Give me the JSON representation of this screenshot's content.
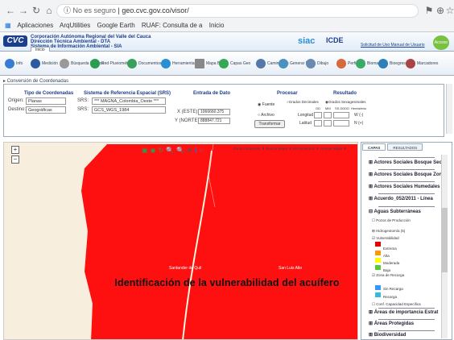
{
  "browser": {
    "url_prefix": "No es seguro",
    "url": "geo.cvc.gov.co/visor/",
    "bookmarks": [
      "Aplicaciones",
      "ArqUtilities",
      "Google Earth",
      "RUAF: Consulta de a",
      "Inicio"
    ]
  },
  "banner": {
    "logo": "CVC",
    "org_lines": [
      "Corporación Autónoma Regional del Valle del Cauca",
      "Dirección Técnica Ambiental - DTA",
      "Sistema de Información Ambiental - SIA"
    ],
    "siac": "siac",
    "icde": "ICDE",
    "manual": "Solicitud de Uso Manual de Usuario",
    "avatar": "Acceso",
    "tab": "Inicio"
  },
  "toolbar": {
    "items": [
      "Info",
      "Medición",
      "Búsqueda Predios",
      "Red Pluviométrica",
      "Documentos",
      "Herramientas",
      "Mapa Base",
      "Capas Geo",
      "Caminantes",
      "Generar Mapa",
      "Dibujo",
      "Perfil",
      "Biomas",
      "Bioegresar",
      "Marcadores",
      "Consultar"
    ]
  },
  "panel": {
    "header": "Conversión de Coordenadas",
    "tipo_title": "Tipo de Coordenadas",
    "sistema_title": "Sistema de Referencia Espacial (SRS)",
    "entrada_title": "Entrada de Dato",
    "procesar_title": "Procesar",
    "resultado_title": "Resultado",
    "origen_label": "Origen:",
    "origen_value": "Planas",
    "destino_label": "Destino:",
    "destino_value": "Geográficas",
    "srs1_label": "SRS:",
    "srs1_value": "*** MAGNA_Colombia_Oeste ***",
    "srs2_label": "SRS:",
    "srs2_value": "GCS_WGS_1984",
    "x_label": "X (ESTE):",
    "x_value": "1066660.375",
    "y_label": "Y (NORTE):",
    "y_value": "888847.721",
    "fuente": "Fuente",
    "archivo": "Archivo",
    "radio_dec": "Grados Decimales",
    "radio_sex": "Grados Sexagesimales",
    "col_gd": "GD",
    "col_mm": "MM",
    "col_ss": "SS.DDDD",
    "col_hemi": "Hemisferio",
    "longitud": "Longitud",
    "latitud": "Latitud",
    "hemi_w": "W (-)",
    "hemi_n": "N (+)",
    "transform": "Transformar"
  },
  "map": {
    "menus": "Zona Condensar ▼   Buscar Mapa ▼   Herramientas ▼   Limpiar Mapa ▼",
    "label_left": "Santander de Quil",
    "label_right": "San Luis Alto",
    "caption": "Identificación de la vulnerabilidad del acuífero",
    "fill_color": "#ff1010"
  },
  "layers": {
    "tabs": [
      "CAPAS",
      "RESULTADOS"
    ],
    "items": [
      "Actores Sociales Bosque Sec",
      "Actores Sociales Bosque Zon",
      "Actores Sociales Humedales",
      "Acuerdo_052/2011 - Línea",
      "Aguas Subterráneas",
      "Áreas de importancia Estrat",
      "Áreas Protegidas",
      "Biodiversidad"
    ],
    "subs": [
      "Pozos de Producción",
      "Hidrogeotomía (5)",
      "Vulnerabilidad",
      "Zona de Recarga",
      "Conf. Capacidad Especifica"
    ],
    "legend": [
      {
        "name": "Extrema",
        "color": "#e60000"
      },
      {
        "name": "Alta",
        "color": "#ff9900"
      },
      {
        "name": "Moderada",
        "color": "#ffff00"
      },
      {
        "name": "Baja",
        "color": "#55cc33"
      },
      {
        "name": "Recarga",
        "color": "#3399ff"
      }
    ],
    "zona_item": "Sin Recarga"
  }
}
